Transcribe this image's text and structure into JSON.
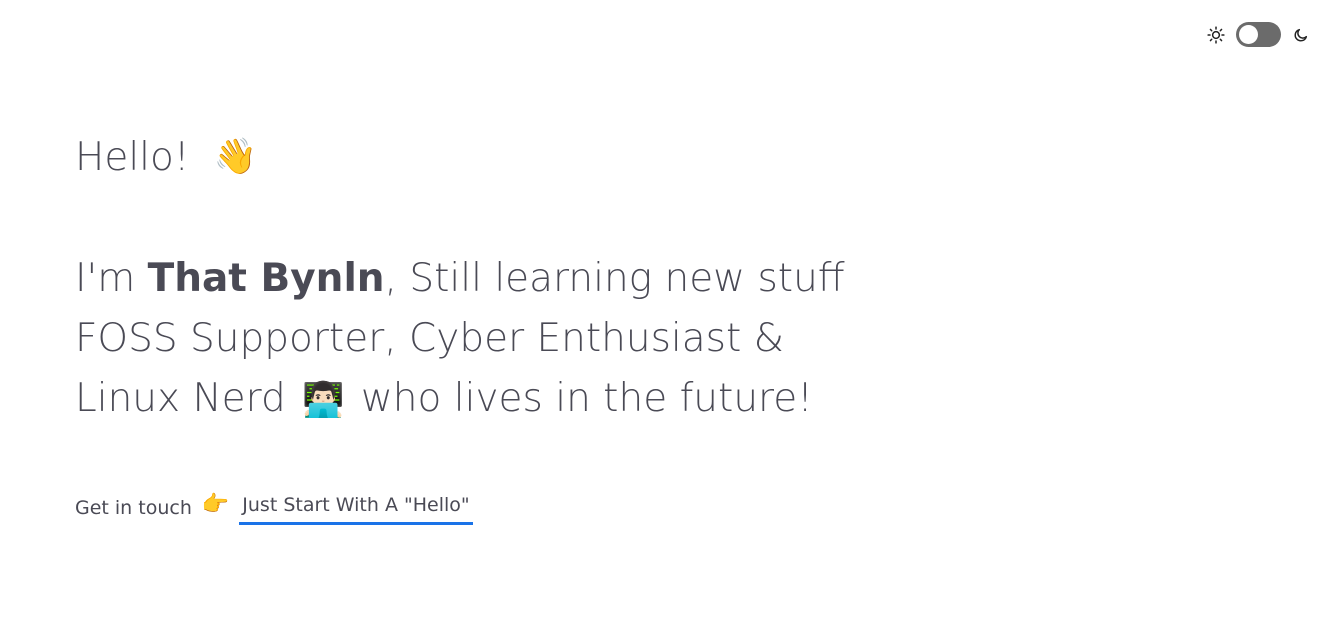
{
  "theme_toggle": {
    "light_icon": "sun-icon",
    "dark_icon": "moon-icon",
    "state": "light"
  },
  "hero": {
    "greeting": "Hello!",
    "greeting_emoji": "👋",
    "intro_prefix": "I'm ",
    "name": "That Bynln",
    "intro_suffix": ", Still learning new stuff",
    "line2": "FOSS Supporter, Cyber Enthusiast &",
    "line3_prefix": "Linux Nerd ",
    "line3_emoji": "👨🏻‍💻",
    "line3_suffix": " who lives in the future!"
  },
  "contact": {
    "label": "Get in touch",
    "emoji": "👉",
    "link_text": "Just Start With A \"Hello\""
  },
  "colors": {
    "text": "#4a4a55",
    "link_underline": "#1a73e8",
    "toggle_track": "#6b6b6b"
  }
}
